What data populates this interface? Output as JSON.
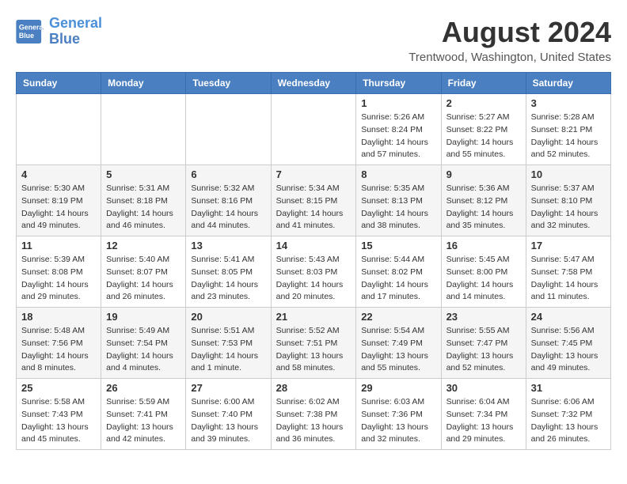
{
  "header": {
    "logo_line1": "General",
    "logo_line2": "Blue",
    "title": "August 2024",
    "subtitle": "Trentwood, Washington, United States"
  },
  "days_of_week": [
    "Sunday",
    "Monday",
    "Tuesday",
    "Wednesday",
    "Thursday",
    "Friday",
    "Saturday"
  ],
  "weeks": [
    [
      {
        "day": "",
        "info": ""
      },
      {
        "day": "",
        "info": ""
      },
      {
        "day": "",
        "info": ""
      },
      {
        "day": "",
        "info": ""
      },
      {
        "day": "1",
        "info": "Sunrise: 5:26 AM\nSunset: 8:24 PM\nDaylight: 14 hours and 57 minutes."
      },
      {
        "day": "2",
        "info": "Sunrise: 5:27 AM\nSunset: 8:22 PM\nDaylight: 14 hours and 55 minutes."
      },
      {
        "day": "3",
        "info": "Sunrise: 5:28 AM\nSunset: 8:21 PM\nDaylight: 14 hours and 52 minutes."
      }
    ],
    [
      {
        "day": "4",
        "info": "Sunrise: 5:30 AM\nSunset: 8:19 PM\nDaylight: 14 hours and 49 minutes."
      },
      {
        "day": "5",
        "info": "Sunrise: 5:31 AM\nSunset: 8:18 PM\nDaylight: 14 hours and 46 minutes."
      },
      {
        "day": "6",
        "info": "Sunrise: 5:32 AM\nSunset: 8:16 PM\nDaylight: 14 hours and 44 minutes."
      },
      {
        "day": "7",
        "info": "Sunrise: 5:34 AM\nSunset: 8:15 PM\nDaylight: 14 hours and 41 minutes."
      },
      {
        "day": "8",
        "info": "Sunrise: 5:35 AM\nSunset: 8:13 PM\nDaylight: 14 hours and 38 minutes."
      },
      {
        "day": "9",
        "info": "Sunrise: 5:36 AM\nSunset: 8:12 PM\nDaylight: 14 hours and 35 minutes."
      },
      {
        "day": "10",
        "info": "Sunrise: 5:37 AM\nSunset: 8:10 PM\nDaylight: 14 hours and 32 minutes."
      }
    ],
    [
      {
        "day": "11",
        "info": "Sunrise: 5:39 AM\nSunset: 8:08 PM\nDaylight: 14 hours and 29 minutes."
      },
      {
        "day": "12",
        "info": "Sunrise: 5:40 AM\nSunset: 8:07 PM\nDaylight: 14 hours and 26 minutes."
      },
      {
        "day": "13",
        "info": "Sunrise: 5:41 AM\nSunset: 8:05 PM\nDaylight: 14 hours and 23 minutes."
      },
      {
        "day": "14",
        "info": "Sunrise: 5:43 AM\nSunset: 8:03 PM\nDaylight: 14 hours and 20 minutes."
      },
      {
        "day": "15",
        "info": "Sunrise: 5:44 AM\nSunset: 8:02 PM\nDaylight: 14 hours and 17 minutes."
      },
      {
        "day": "16",
        "info": "Sunrise: 5:45 AM\nSunset: 8:00 PM\nDaylight: 14 hours and 14 minutes."
      },
      {
        "day": "17",
        "info": "Sunrise: 5:47 AM\nSunset: 7:58 PM\nDaylight: 14 hours and 11 minutes."
      }
    ],
    [
      {
        "day": "18",
        "info": "Sunrise: 5:48 AM\nSunset: 7:56 PM\nDaylight: 14 hours and 8 minutes."
      },
      {
        "day": "19",
        "info": "Sunrise: 5:49 AM\nSunset: 7:54 PM\nDaylight: 14 hours and 4 minutes."
      },
      {
        "day": "20",
        "info": "Sunrise: 5:51 AM\nSunset: 7:53 PM\nDaylight: 14 hours and 1 minute."
      },
      {
        "day": "21",
        "info": "Sunrise: 5:52 AM\nSunset: 7:51 PM\nDaylight: 13 hours and 58 minutes."
      },
      {
        "day": "22",
        "info": "Sunrise: 5:54 AM\nSunset: 7:49 PM\nDaylight: 13 hours and 55 minutes."
      },
      {
        "day": "23",
        "info": "Sunrise: 5:55 AM\nSunset: 7:47 PM\nDaylight: 13 hours and 52 minutes."
      },
      {
        "day": "24",
        "info": "Sunrise: 5:56 AM\nSunset: 7:45 PM\nDaylight: 13 hours and 49 minutes."
      }
    ],
    [
      {
        "day": "25",
        "info": "Sunrise: 5:58 AM\nSunset: 7:43 PM\nDaylight: 13 hours and 45 minutes."
      },
      {
        "day": "26",
        "info": "Sunrise: 5:59 AM\nSunset: 7:41 PM\nDaylight: 13 hours and 42 minutes."
      },
      {
        "day": "27",
        "info": "Sunrise: 6:00 AM\nSunset: 7:40 PM\nDaylight: 13 hours and 39 minutes."
      },
      {
        "day": "28",
        "info": "Sunrise: 6:02 AM\nSunset: 7:38 PM\nDaylight: 13 hours and 36 minutes."
      },
      {
        "day": "29",
        "info": "Sunrise: 6:03 AM\nSunset: 7:36 PM\nDaylight: 13 hours and 32 minutes."
      },
      {
        "day": "30",
        "info": "Sunrise: 6:04 AM\nSunset: 7:34 PM\nDaylight: 13 hours and 29 minutes."
      },
      {
        "day": "31",
        "info": "Sunrise: 6:06 AM\nSunset: 7:32 PM\nDaylight: 13 hours and 26 minutes."
      }
    ]
  ]
}
